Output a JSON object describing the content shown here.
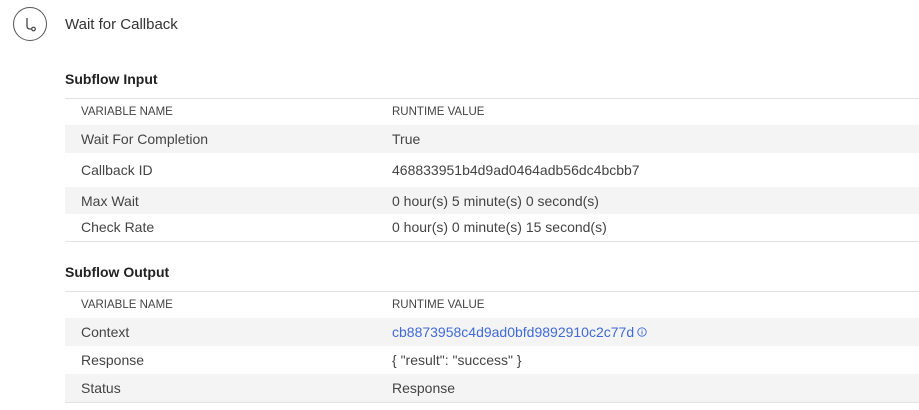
{
  "step": {
    "title": "Wait for Callback",
    "icon": "flow-branch-icon"
  },
  "subflow_input": {
    "title": "Subflow Input",
    "columns": [
      "VARIABLE NAME",
      "RUNTIME VALUE"
    ],
    "rows": [
      {
        "name": "Wait For Completion",
        "value": "True"
      },
      {
        "name": "Callback ID",
        "value": "468833951b4d9ad0464adb56dc4bcbb7"
      },
      {
        "name": "Max Wait",
        "value": "0 hour(s) 5 minute(s) 0 second(s)"
      },
      {
        "name": "Check Rate",
        "value": "0 hour(s) 0 minute(s) 15 second(s)"
      }
    ]
  },
  "subflow_output": {
    "title": "Subflow Output",
    "columns": [
      "VARIABLE NAME",
      "RUNTIME VALUE"
    ],
    "rows": [
      {
        "name": "Context",
        "value": "cb8873958c4d9ad0bfd9892910c2c77d",
        "link": true
      },
      {
        "name": "Response",
        "value": "{ \"result\": \"success\" }"
      },
      {
        "name": "Status",
        "value": "Response"
      }
    ]
  },
  "colors": {
    "link": "#3f6ad8",
    "stripe": "#f4f4f4"
  }
}
